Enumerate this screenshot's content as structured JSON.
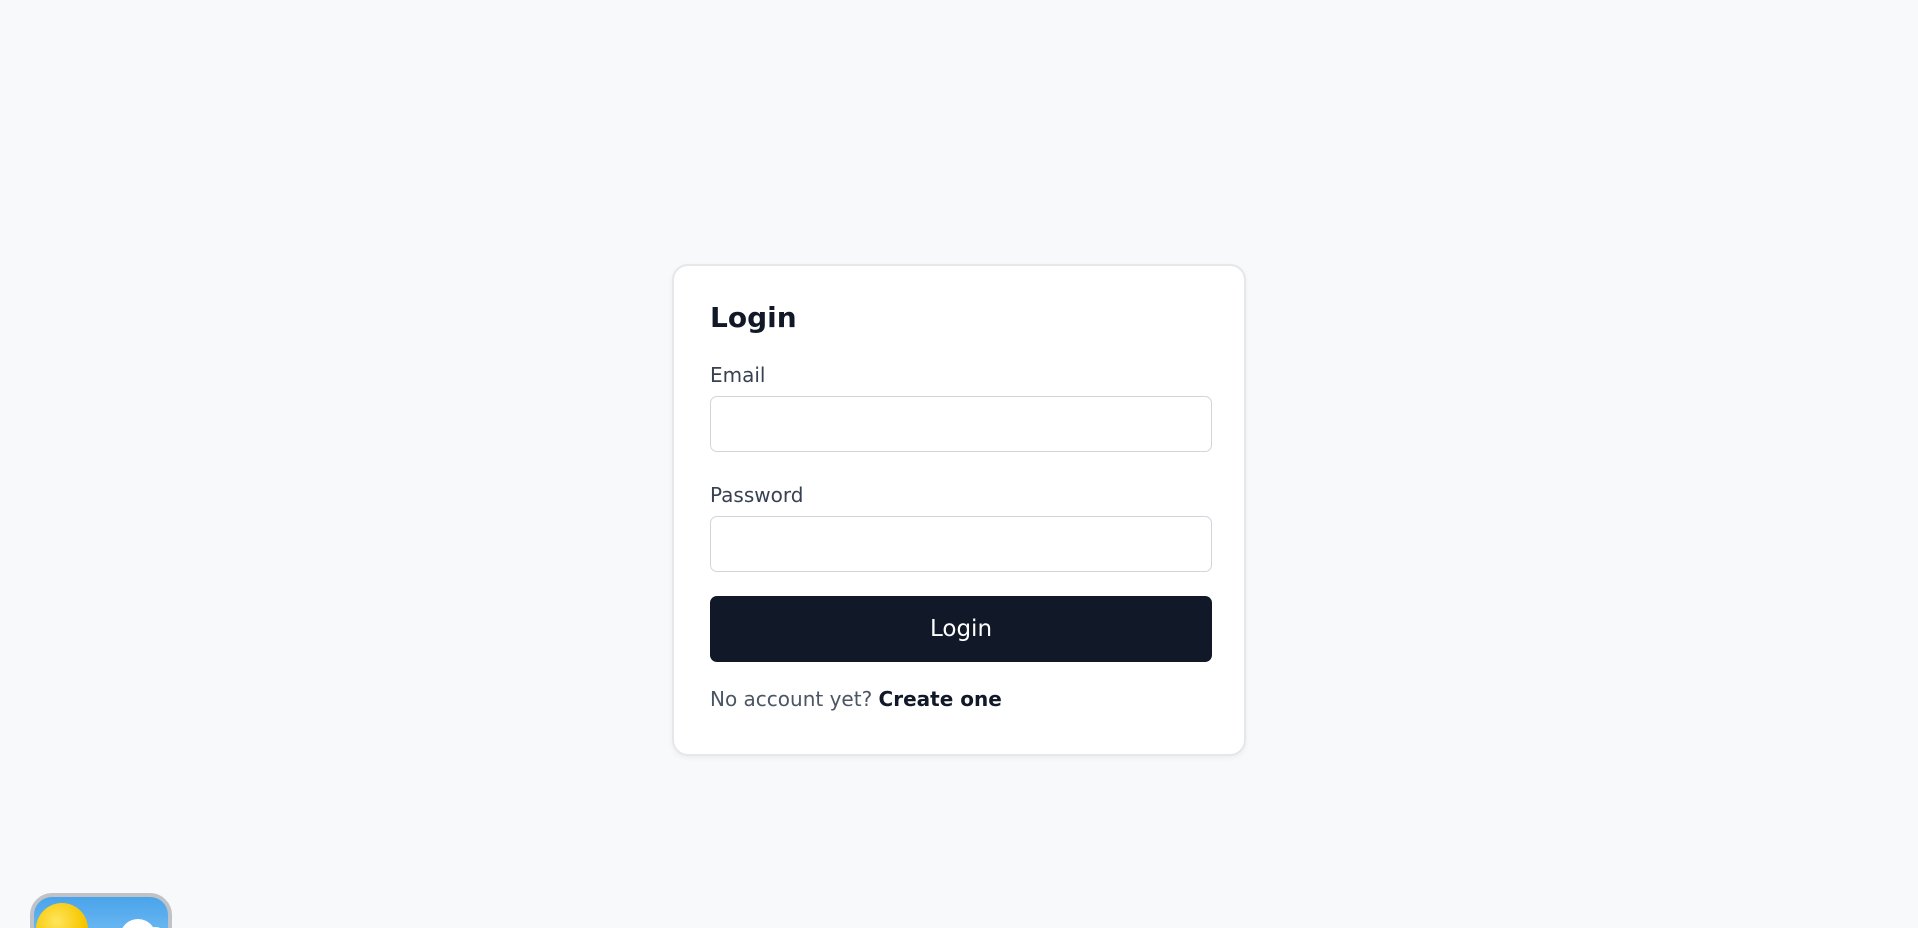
{
  "login": {
    "title": "Login",
    "email_label": "Email",
    "email_value": "",
    "password_label": "Password",
    "password_value": "",
    "submit_label": "Login",
    "no_account_text": "No account yet?",
    "create_link_label": "Create one"
  },
  "colors": {
    "background": "#f8f9fb",
    "card": "#ffffff",
    "primary_button": "#111827",
    "primary_button_text": "#ffffff"
  },
  "widget": {
    "icon": "weather-sun-cloud-icon"
  }
}
